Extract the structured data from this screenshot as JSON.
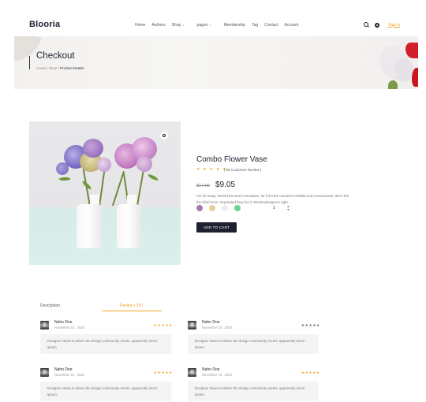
{
  "header": {
    "logo": "Blooria",
    "nav": [
      "Home",
      "Authors",
      "Shop",
      "pages",
      "Membership",
      "Tag",
      "Contact",
      "Account"
    ],
    "signin": "Sign in"
  },
  "banner": {
    "title": "Checkout",
    "breadcrumb": [
      "Home",
      "Shop",
      "Product Details"
    ]
  },
  "product": {
    "name": "Combo Flower Vase",
    "stars": "★ ★ ★ ★ ★",
    "review_count": "( 25 Customer Review )",
    "price_old": "$17.00",
    "price_new": "$9.05",
    "description": "Far far away, behind the word mountains, far from the countries Vokalia and Consonantia, there live the blind texts. Separated they live in Bookmarksgrove right",
    "swatch_colors": [
      "#a877b3",
      "#e6cf9a",
      "#ececec",
      "#6fd18f"
    ],
    "quantity": "1",
    "add_to_cart": "ADD TO CART"
  },
  "tabs": {
    "description": "Description",
    "review": "Review ( 25 )"
  },
  "reviews": [
    {
      "name": "Naho Doe",
      "date": "November 10 , 2020",
      "stars": "★★★★★",
      "star_color": "#f4a21c",
      "text": "Designer News is where the design community meets, apparently lorem ipsum."
    },
    {
      "name": "Naho Doe",
      "date": "November 10 , 2020",
      "stars": "★★★★★",
      "star_color": "#555555",
      "text": "Designer News is where the design community meets, apparently lorem ipsum."
    },
    {
      "name": "Naho Doe",
      "date": "November 10 , 2020",
      "stars": "★★★★★",
      "star_color": "#f4a21c",
      "text": "Designer News is where the design community meets, apparently lorem ipsum."
    },
    {
      "name": "Naho Doe",
      "date": "November 10 , 2020",
      "stars": "★★★★★",
      "star_color": "#f4a21c",
      "text": "Designer News is where the design community meets, apparently lorem ipsum."
    }
  ]
}
